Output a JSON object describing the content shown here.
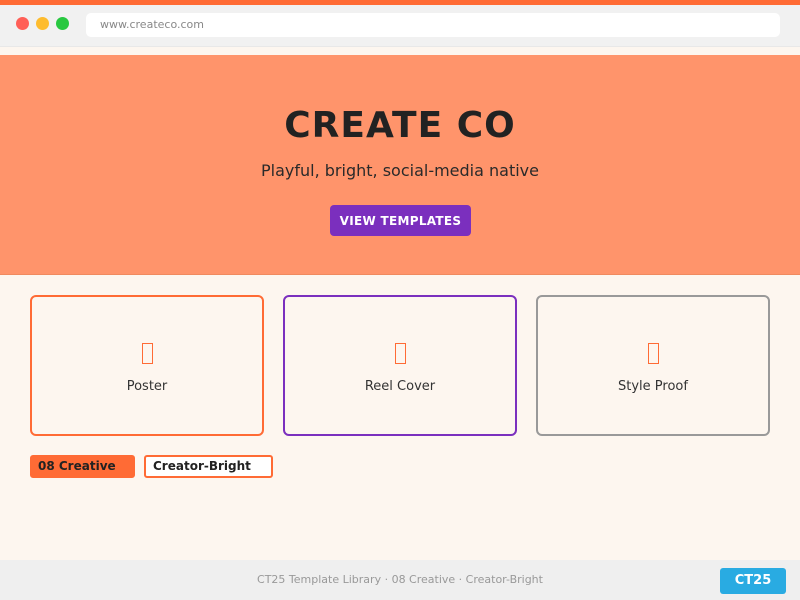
{
  "browser": {
    "url": "www.createco.com"
  },
  "hero": {
    "title": "CREATE CO",
    "subtitle": "Playful, bright, social-media native",
    "cta_label": "VIEW TEMPLATES"
  },
  "cards": [
    {
      "label": "Poster",
      "icon": "missing-glyph-icon"
    },
    {
      "label": "Reel Cover",
      "icon": "missing-glyph-icon"
    },
    {
      "label": "Style Proof",
      "icon": "missing-glyph-icon"
    }
  ],
  "tags": [
    {
      "label": "08 Creative"
    },
    {
      "label": "Creator-Bright"
    }
  ],
  "footer": {
    "text": "CT25 Template Library · 08 Creative · Creator-Bright",
    "badge": "CT25"
  },
  "colors": {
    "accent": "#ff6b35",
    "hero_bg": "#ff946b",
    "purple": "#7b2fbe",
    "badge_blue": "#29abe2",
    "page_bg": "#fdf6ef"
  }
}
